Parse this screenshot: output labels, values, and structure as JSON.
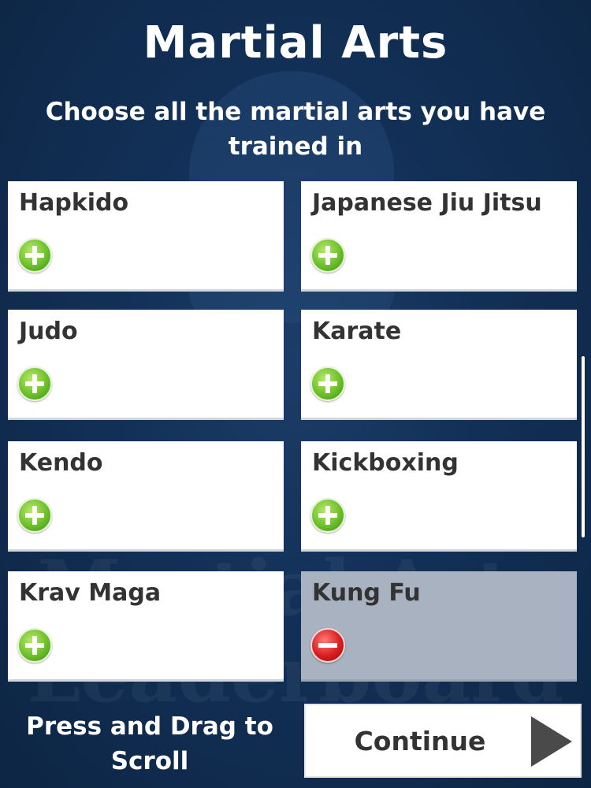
{
  "header": {
    "title": "Martial Arts",
    "subtitle": "Choose all the martial arts you have trained in"
  },
  "grid": {
    "items": [
      {
        "label": "Hapkido",
        "selected": false,
        "icon": "plus-icon"
      },
      {
        "label": "Japanese Jiu Jitsu",
        "selected": false,
        "icon": "plus-icon"
      },
      {
        "label": "Judo",
        "selected": false,
        "icon": "plus-icon"
      },
      {
        "label": "Karate",
        "selected": false,
        "icon": "plus-icon"
      },
      {
        "label": "Kendo",
        "selected": false,
        "icon": "plus-icon"
      },
      {
        "label": "Kickboxing",
        "selected": false,
        "icon": "plus-icon"
      },
      {
        "label": "Krav Maga",
        "selected": false,
        "icon": "plus-icon"
      },
      {
        "label": "Kung Fu",
        "selected": true,
        "icon": "minus-icon"
      }
    ]
  },
  "footer": {
    "scroll_hint": "Press and Drag to Scroll",
    "continue_label": "Continue",
    "continue_icon": "play-arrow-icon"
  },
  "watermark": {
    "line1": "Martial Arts",
    "line2": "Leaderboard"
  },
  "colors": {
    "background": "#0f2a4c",
    "card": "#ffffff",
    "card_selected": "#a9b2c0",
    "add_green": "#6cc02c",
    "remove_red": "#d81e1e"
  }
}
